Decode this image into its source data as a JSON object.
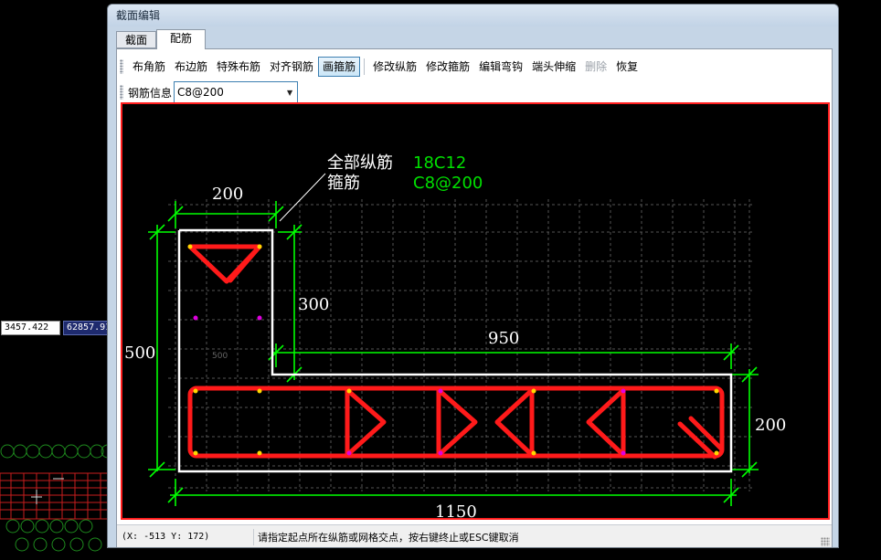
{
  "background": {
    "coord_x": "3457.422",
    "coord_y": "62857.91"
  },
  "window": {
    "title": "截面编辑",
    "tabs": [
      {
        "label": "截面",
        "active": false
      },
      {
        "label": "配筋",
        "active": true
      }
    ],
    "toolbar1": [
      {
        "label": "布角筋",
        "state": "normal"
      },
      {
        "label": "布边筋",
        "state": "normal"
      },
      {
        "label": "特殊布筋",
        "state": "normal"
      },
      {
        "label": "对齐钢筋",
        "state": "normal"
      },
      {
        "label": "画箍筋",
        "state": "active"
      },
      {
        "label": "修改纵筋",
        "state": "normal"
      },
      {
        "label": "修改箍筋",
        "state": "normal"
      },
      {
        "label": "编辑弯钩",
        "state": "normal"
      },
      {
        "label": "端头伸缩",
        "state": "normal"
      },
      {
        "label": "删除",
        "state": "disabled"
      },
      {
        "label": "恢复",
        "state": "normal"
      }
    ],
    "toolbar2": {
      "label": "钢筋信息",
      "value": "C8@200"
    },
    "status": {
      "coords": "(X: -513 Y: 172)",
      "message": "请指定起点所在纵筋或网格交点，按右键终止或ESC键取消"
    }
  },
  "drawing": {
    "annotation": {
      "line1_label": "全部纵筋",
      "line1_value": "18C12",
      "line2_label": "箍筋",
      "line2_value": "C8@200"
    },
    "dimensions": {
      "top_width": "200",
      "left_height": "500",
      "flange_height": "300",
      "web_length": "950",
      "right_height": "200",
      "total_width": "1150",
      "faint_label": "500"
    },
    "colors": {
      "dimension": "#00ff00",
      "outline": "#ffffff",
      "stirrup": "#ff1a1a",
      "grid": "#555555",
      "bar_yellow": "#ffd700",
      "bar_magenta": "#e000e0",
      "annotation_text": "#ffffff",
      "annotation_value": "#00e000"
    }
  }
}
